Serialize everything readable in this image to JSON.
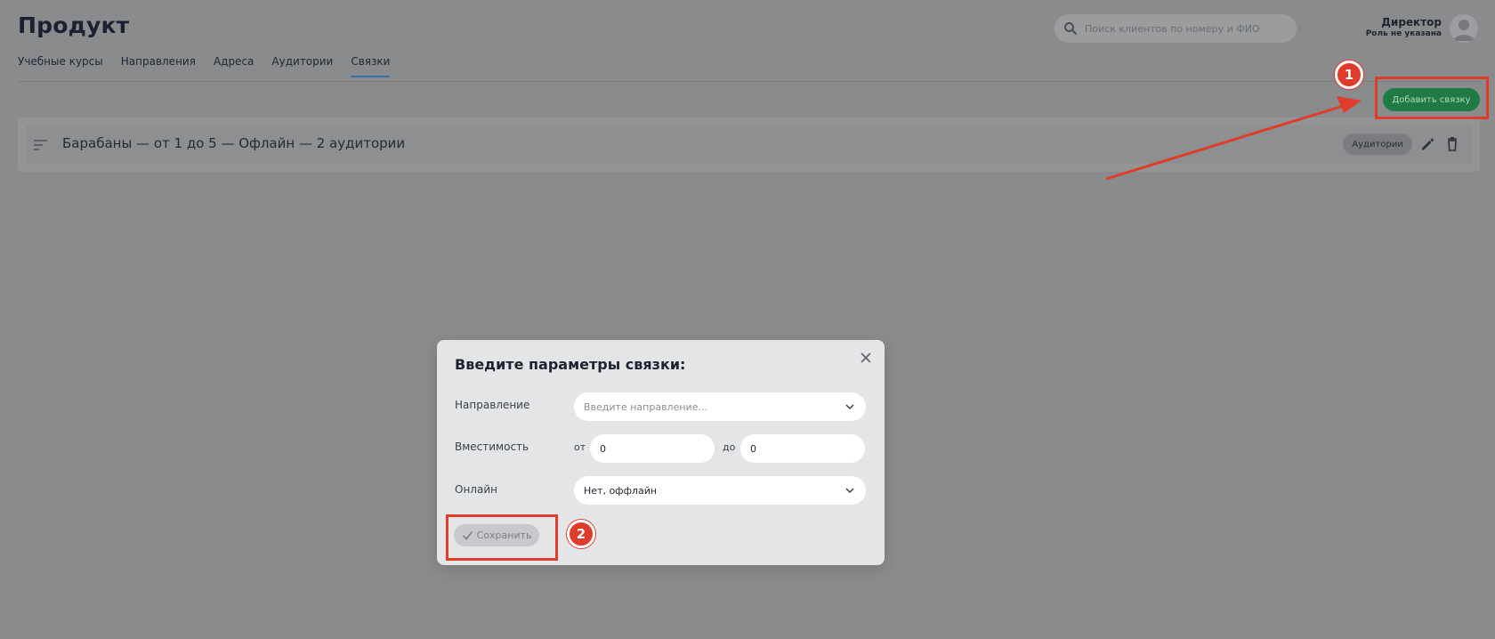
{
  "header": {
    "title": "Продукт",
    "search_placeholder": "Поиск клиентов по номеру и ФИО",
    "user_role": "Директор",
    "user_note": "Роль не указана"
  },
  "tabs": [
    {
      "label": "Учебные курсы",
      "active": false
    },
    {
      "label": "Направления",
      "active": false
    },
    {
      "label": "Адреса",
      "active": false
    },
    {
      "label": "Аудитории",
      "active": false
    },
    {
      "label": "Связки",
      "active": true
    }
  ],
  "toolbar": {
    "add_button_label": "Добавить связку"
  },
  "list": {
    "items": [
      {
        "title": "Барабаны — от 1 до 5 — Офлайн — 2 аудитории",
        "chip_label": "Аудитории"
      }
    ]
  },
  "modal": {
    "title": "Введите параметры связки:",
    "direction_label": "Направление",
    "direction_placeholder": "Введите направление...",
    "capacity_label": "Вместимость",
    "from_label": "от",
    "from_value": "0",
    "to_label": "до",
    "to_value": "0",
    "online_label": "Онлайн",
    "online_value": "Нет, оффлайн",
    "save_label": "Сохранить"
  },
  "annotations": [
    {
      "number": "1"
    },
    {
      "number": "2"
    }
  ],
  "colors": {
    "accent_green": "#1f7a44",
    "annotation_red": "#e03c2c",
    "tab_underline": "#3a6fb0"
  }
}
